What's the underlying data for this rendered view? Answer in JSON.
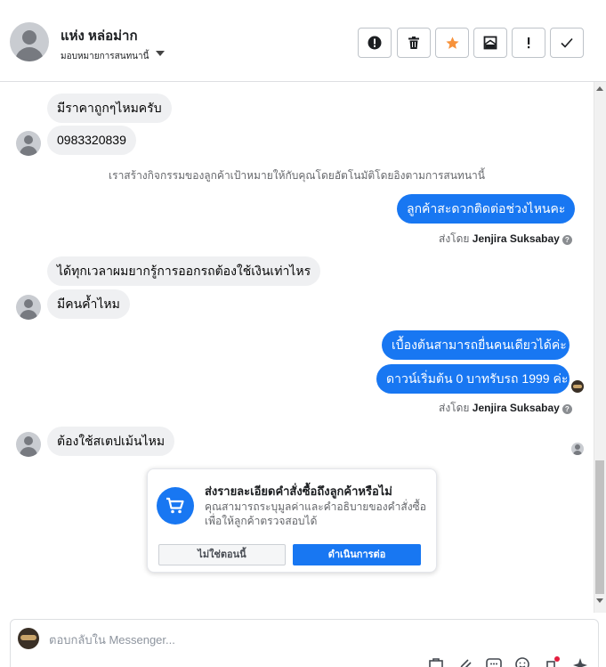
{
  "header": {
    "contact_name": "แห่ง หล่อม่าก",
    "assign_label": "มอบหมายการสนทนานี้"
  },
  "thread": {
    "messages": [
      {
        "direction": "incoming",
        "text": "มีราคาถูกๆไหมครับ"
      },
      {
        "direction": "incoming",
        "text": "0983320839"
      },
      {
        "direction": "outgoing",
        "text": "ลูกค้าสะดวกติดต่อช่วงไหนคะ"
      },
      {
        "direction": "incoming",
        "text": "ได้ทุกเวลาผมยากรู้การออกรถต้องใช้เงินเท่าไหร"
      },
      {
        "direction": "incoming",
        "text": "มีคนค้ำไหม"
      },
      {
        "direction": "outgoing",
        "text": "เบื้องต้นสามารถยื่นคนเดียวได้ค่ะ"
      },
      {
        "direction": "outgoing",
        "text": "ดาวน์เริ่มต้น 0 บาทรับรถ 1999 ค่ะ"
      },
      {
        "direction": "incoming",
        "text": "ต้องใช้สเตปเม้นไหม"
      }
    ],
    "system_note": "เราสร้างกิจกรรมของลูกค้าเป้าหมายให้กับคุณโดยอัตโนมัติโดยอิงตามการสนทนานี้",
    "sent_by_prefix": "ส่งโดย",
    "sent_by_name": "Jenjira Suksabay"
  },
  "order_card": {
    "title": "ส่งรายละเอียดคำสั่งซื้อถึงลูกค้าหรือไม่",
    "description": "คุณสามารถระบุมูลค่าและคำอธิบายของคำสั่งซื้อเพื่อให้ลูกค้าตรวจสอบได้",
    "secondary_button": "ไม่ใช่ตอนนี้",
    "primary_button": "ดำเนินการต่อ"
  },
  "composer": {
    "placeholder": "ตอบกลับใน Messenger..."
  },
  "colors": {
    "accent": "#1877f2",
    "incoming_bubble": "#eff0f2",
    "star": "#f7923b",
    "notification_dot": "#e41e3f"
  },
  "icons": {
    "header_actions": [
      "spam-icon",
      "trash-icon",
      "star-icon",
      "mark-unread-icon",
      "follow-up-icon",
      "done-check-icon"
    ],
    "composer_tools": [
      "bag-icon",
      "attachment-icon",
      "saved-reply-icon",
      "emoji-icon",
      "appointment-icon",
      "sparkle-icon"
    ]
  }
}
